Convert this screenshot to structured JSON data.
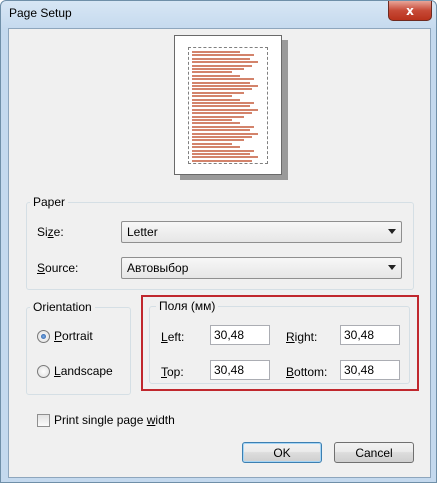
{
  "window": {
    "title": "Page Setup",
    "close_glyph": "x"
  },
  "preview": {
    "text_lines": 33
  },
  "paper": {
    "group_label": "Paper",
    "size": {
      "label_pre": "Si",
      "label_key": "z",
      "label_post": "e:",
      "value": "Letter"
    },
    "source": {
      "label_pre": "",
      "label_key": "S",
      "label_post": "ource:",
      "value": "Автовыбор"
    }
  },
  "orientation": {
    "group_label": "Orientation",
    "portrait": {
      "label_pre": "",
      "label_key": "P",
      "label_post": "ortrait",
      "selected": true
    },
    "landscape": {
      "label_pre": "",
      "label_key": "L",
      "label_post": "andscape",
      "selected": false
    }
  },
  "margins": {
    "group_label": "Поля (мм)",
    "left": {
      "label_pre": "",
      "label_key": "L",
      "label_post": "eft:",
      "value": "30,48"
    },
    "right": {
      "label_pre": "",
      "label_key": "R",
      "label_post": "ight:",
      "value": "30,48"
    },
    "top": {
      "label_pre": "",
      "label_key": "T",
      "label_post": "op:",
      "value": "30,48"
    },
    "bottom": {
      "label_pre": "",
      "label_key": "B",
      "label_post": "ottom:",
      "value": "30,48"
    },
    "highlight_color": "#c0272d"
  },
  "print_width": {
    "label_pre": "Print single page ",
    "label_key": "w",
    "label_post": "idth",
    "checked": false
  },
  "buttons": {
    "ok": "OK",
    "cancel": "Cancel"
  }
}
